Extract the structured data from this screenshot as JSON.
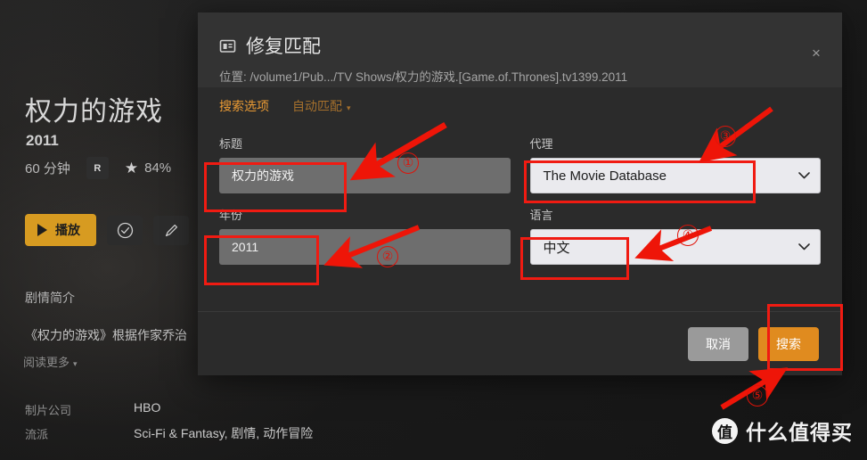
{
  "background": {
    "title": "权力的游戏",
    "year": "2011",
    "runtime": "60 分钟",
    "content_rating": "R",
    "score": "84%",
    "star_icon": "star-icon",
    "play_label": "播放",
    "watched_icon": "check-circle-icon",
    "edit_icon": "pencil-icon",
    "overview_heading": "剧情简介",
    "overview_text": "《权力的游戏》根据作家乔治",
    "read_more": "阅读更多",
    "read_more_caret": "▾",
    "facts": [
      {
        "label": "制片公司",
        "value": "HBO"
      },
      {
        "label": "流派",
        "value": "Sci-Fi & Fantasy, 剧情, 动作冒险"
      }
    ]
  },
  "watermark": {
    "badge": "值",
    "text": "什么值得买"
  },
  "modal": {
    "icon": "identify-media-icon",
    "title": "修复匹配",
    "path": "位置: /volume1/Pub.../TV Shows/权力的游戏.[Game.of.Thrones].tv1399.2011",
    "close_icon": "×",
    "tabs": [
      {
        "label": "搜索选项",
        "active": true
      },
      {
        "label": "自动匹配",
        "active": false,
        "caret": "▾"
      }
    ],
    "fields": {
      "title": {
        "label": "标题",
        "value": "权力的游戏",
        "placeholder": ""
      },
      "agent": {
        "label": "代理",
        "value": "The Movie Database",
        "caret": "chevron-down-icon"
      },
      "year": {
        "label": "年份",
        "value": "2011",
        "placeholder": ""
      },
      "language": {
        "label": "语言",
        "value": "中文",
        "caret": "chevron-down-icon"
      }
    },
    "footer": {
      "cancel_label": "取消",
      "search_label": "搜索"
    }
  },
  "annotations": {
    "numbers": [
      "①",
      "②",
      "③",
      "④",
      "⑤"
    ],
    "color": "#e01309"
  }
}
